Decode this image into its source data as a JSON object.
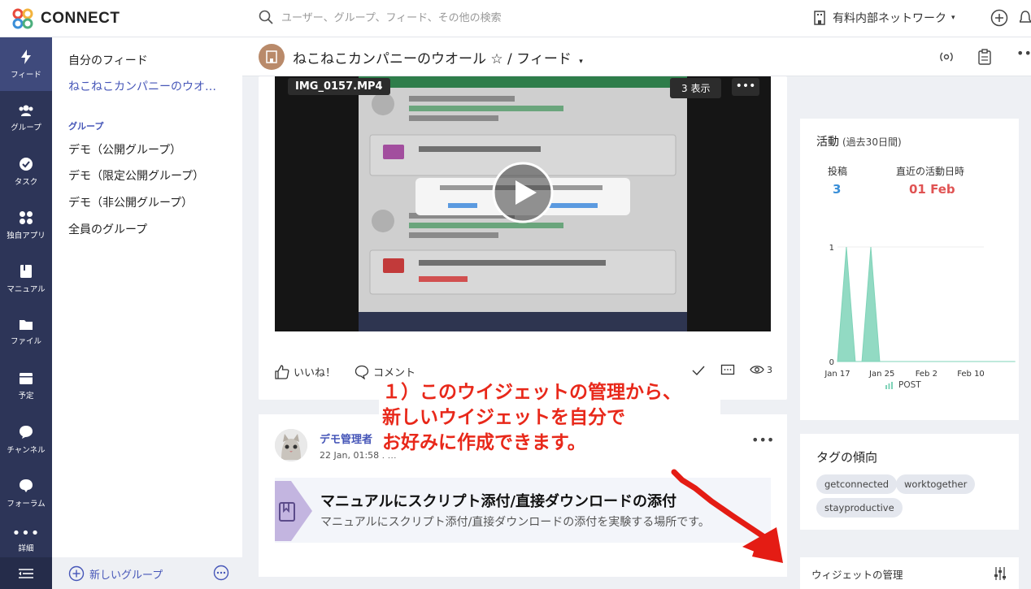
{
  "app": {
    "name": "CONNECT"
  },
  "search": {
    "placeholder": "ユーザー、グループ、フィード、その他の検索"
  },
  "network": {
    "label": "有料内部ネットワーク"
  },
  "rail": {
    "items": [
      {
        "label": "フィード",
        "icon": "lightning-icon"
      },
      {
        "label": "グループ",
        "icon": "people-icon"
      },
      {
        "label": "タスク",
        "icon": "check-circle-icon"
      },
      {
        "label": "独自アプリ",
        "icon": "apps-icon"
      },
      {
        "label": "マニュアル",
        "icon": "book-icon"
      },
      {
        "label": "ファイル",
        "icon": "folder-icon"
      },
      {
        "label": "予定",
        "icon": "calendar-icon"
      },
      {
        "label": "チャンネル",
        "icon": "chat-icon"
      },
      {
        "label": "フォーラム",
        "icon": "forum-icon"
      },
      {
        "label": "詳細",
        "icon": "more-icon"
      }
    ]
  },
  "sidebar": {
    "my_feed": "自分のフィード",
    "company": "ねこねこカンパニーのウオ…",
    "section": "グループ",
    "groups": [
      "デモ（公開グループ）",
      "デモ（限定公開グループ）",
      "デモ（非公開グループ）",
      "全員のグループ"
    ],
    "new_group": "新しいグループ"
  },
  "header": {
    "title": "ねこねこカンパニーのウオール ☆ / フィード"
  },
  "post1": {
    "video_name": "IMG_0157.MP4",
    "views_badge": "3 表示",
    "like": "いいね！",
    "comment": "コメント",
    "view_count": "3"
  },
  "post2": {
    "author": "デモ管理者",
    "time": "22 Jan, 01:58 . …",
    "title": "マニュアルにスクリプト添付/直接ダウンロードの添付",
    "desc": "マニュアルにスクリプト添付/直接ダウンロードの添付を実験する場所です。"
  },
  "annotation": {
    "line1": "１）このウイジェットの管理から、",
    "line2": "新しいウイジェットを自分で",
    "line3": "お好みに作成できます。"
  },
  "activity": {
    "title": "活動",
    "subtitle": "(過去30日間)",
    "posts_label": "投稿",
    "posts_value": "3",
    "last_label": "直近の活動日時",
    "last_value": "01 Feb",
    "colors": {
      "posts": "#3a8fd8",
      "last": "#e05353",
      "series": "#7fd3b8"
    }
  },
  "chart_data": {
    "type": "area",
    "x": [
      "Jan 17",
      "Jan 25",
      "Feb 2",
      "Feb 10"
    ],
    "yticks": [
      "0",
      "1"
    ],
    "ylim": [
      0,
      1
    ],
    "series": [
      {
        "name": "POST",
        "points": [
          [
            0.0,
            0
          ],
          [
            0.2,
            1
          ],
          [
            0.4,
            0
          ],
          [
            0.55,
            0
          ],
          [
            0.75,
            1
          ],
          [
            0.95,
            0
          ],
          [
            4.0,
            0
          ]
        ]
      }
    ],
    "legend": "bottom"
  },
  "tags": {
    "title": "タグの傾向",
    "items": [
      "getconnected",
      "worktogether",
      "stayproductive"
    ]
  },
  "widgets": {
    "title": "ウィジェットの管理"
  }
}
